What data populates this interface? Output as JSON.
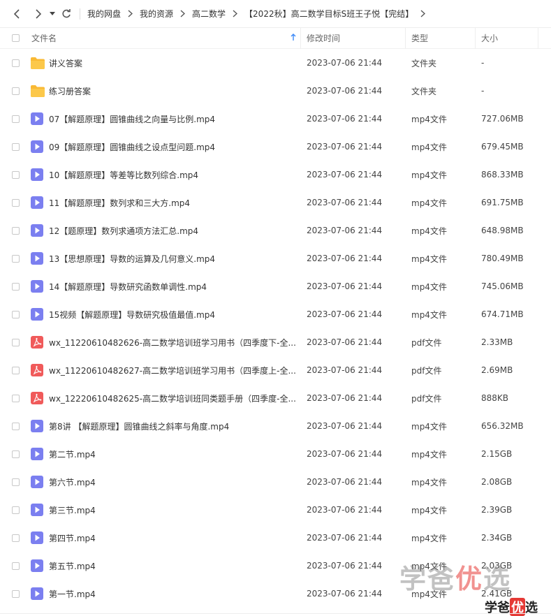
{
  "nav": {
    "breadcrumbs": [
      "我的网盘",
      "我的资源",
      "高二数学",
      "【2022秋】高二数学目标S班王子悦【完结】"
    ]
  },
  "table": {
    "columns": {
      "name": "文件名",
      "modified": "修改时间",
      "type": "类型",
      "size": "大小"
    },
    "rows": [
      {
        "icon": "folder-icon",
        "name": "讲义答案",
        "modified": "2023-07-06 21:44",
        "type": "文件夹",
        "size": "-"
      },
      {
        "icon": "folder-icon",
        "name": "练习册答案",
        "modified": "2023-07-06 21:44",
        "type": "文件夹",
        "size": "-"
      },
      {
        "icon": "video-icon",
        "name": "07【解题原理】圆锥曲线之向量与比例.mp4",
        "modified": "2023-07-06 21:44",
        "type": "mp4文件",
        "size": "727.06MB"
      },
      {
        "icon": "video-icon",
        "name": "09【解题原理】圆锥曲线之设点型问题.mp4",
        "modified": "2023-07-06 21:44",
        "type": "mp4文件",
        "size": "679.45MB"
      },
      {
        "icon": "video-icon",
        "name": "10【解题原理】等差等比数列综合.mp4",
        "modified": "2023-07-06 21:44",
        "type": "mp4文件",
        "size": "868.33MB"
      },
      {
        "icon": "video-icon",
        "name": "11【解题原理】数列求和三大方.mp4",
        "modified": "2023-07-06 21:44",
        "type": "mp4文件",
        "size": "691.75MB"
      },
      {
        "icon": "video-icon",
        "name": "12【题原理】数列求通项方法汇总.mp4",
        "modified": "2023-07-06 21:44",
        "type": "mp4文件",
        "size": "648.98MB"
      },
      {
        "icon": "video-icon",
        "name": "13【思想原理】导数的运算及几何意义.mp4",
        "modified": "2023-07-06 21:44",
        "type": "mp4文件",
        "size": "780.49MB"
      },
      {
        "icon": "video-icon",
        "name": "14【解题原理】导数研究函数单调性.mp4",
        "modified": "2023-07-06 21:44",
        "type": "mp4文件",
        "size": "745.06MB"
      },
      {
        "icon": "video-icon",
        "name": "15视频【解题原理】导数研究极值最值.mp4",
        "modified": "2023-07-06 21:44",
        "type": "mp4文件",
        "size": "674.71MB"
      },
      {
        "icon": "pdf-icon",
        "name": "wx_11220610482626-高二数学培训班学习用书（四季度下-全...",
        "modified": "2023-07-06 21:44",
        "type": "pdf文件",
        "size": "2.33MB"
      },
      {
        "icon": "pdf-icon",
        "name": "wx_11220610482627-高二数学培训班学习用书（四季度上-全...",
        "modified": "2023-07-06 21:44",
        "type": "pdf文件",
        "size": "2.69MB"
      },
      {
        "icon": "pdf-icon",
        "name": "wx_12220610482625-高二数学培训班同类题手册（四季度-全...",
        "modified": "2023-07-06 21:44",
        "type": "pdf文件",
        "size": "888KB"
      },
      {
        "icon": "video-icon",
        "name": "第8讲 【解题原理】圆锥曲线之斜率与角度.mp4",
        "modified": "2023-07-06 21:44",
        "type": "mp4文件",
        "size": "656.32MB"
      },
      {
        "icon": "video-icon",
        "name": "第二节.mp4",
        "modified": "2023-07-06 21:44",
        "type": "mp4文件",
        "size": "2.15GB"
      },
      {
        "icon": "video-icon",
        "name": "第六节.mp4",
        "modified": "2023-07-06 21:44",
        "type": "mp4文件",
        "size": "2.08GB"
      },
      {
        "icon": "video-icon",
        "name": "第三节.mp4",
        "modified": "2023-07-06 21:44",
        "type": "mp4文件",
        "size": "2.39GB"
      },
      {
        "icon": "video-icon",
        "name": "第四节.mp4",
        "modified": "2023-07-06 21:44",
        "type": "mp4文件",
        "size": "2.34GB"
      },
      {
        "icon": "video-icon",
        "name": "第五节.mp4",
        "modified": "2023-07-06 21:44",
        "type": "mp4文件",
        "size": "2.03GB"
      },
      {
        "icon": "video-icon",
        "name": "第一节.mp4",
        "modified": "2023-07-06 21:44",
        "type": "mp4文件",
        "size": "2.41GB"
      }
    ]
  },
  "watermark": {
    "big_a": "学爸",
    "big_b": "优",
    "big_c": "选",
    "small_a": "学爸",
    "small_b": "优",
    "small_c": "选"
  },
  "colors": {
    "folder": "#f9b934",
    "video": "#7b7ff0",
    "pdf": "#f05a5a",
    "accent": "#3d8af7"
  }
}
